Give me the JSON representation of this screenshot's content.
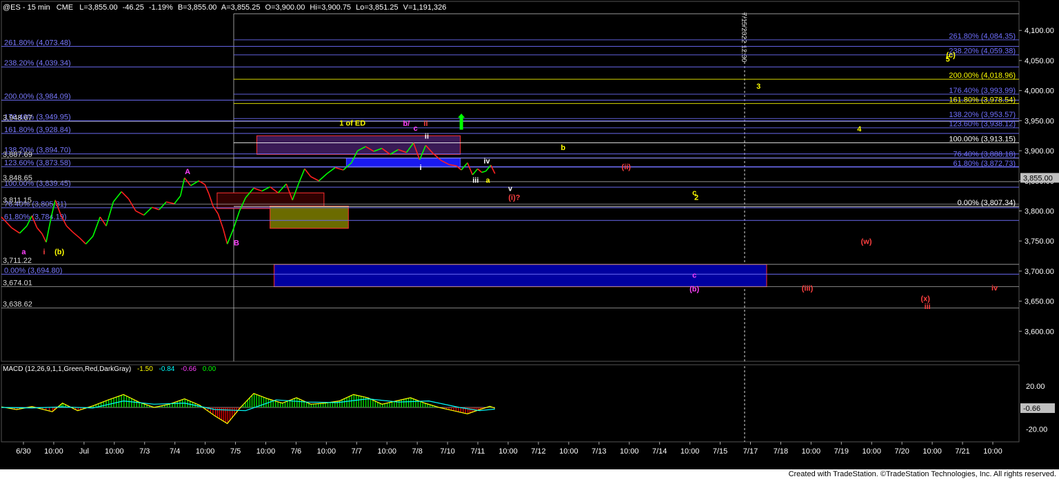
{
  "header": {
    "symbol": "@ES - 15 min",
    "exchange": "CME",
    "last": "L=3,855.00",
    "change": "-46.25",
    "change_pct": "-1.19%",
    "bid": "B=3,855.00",
    "ask": "A=3,855.25",
    "open": "O=3,900.00",
    "high": "Hi=3,900.75",
    "low": "Lo=3,851.25",
    "volume": "V=1,191,326"
  },
  "footer": {
    "credit": "Created with TradeStation. ©TradeStation Technologies, Inc. All rights reserved."
  },
  "colors": {
    "bull": "#00ff00",
    "bear": "#ff2020",
    "fib_left": "#7070ff",
    "fib_yellow": "#ffffff",
    "fib_right": "#4040ff",
    "price_box": "#ff4040"
  },
  "chart_data": {
    "type": "line",
    "price_axis": {
      "ylim": [
        3550,
        4130
      ],
      "ticks": [
        "4,100.00",
        "4,050.00",
        "4,000.00",
        "3,950.00",
        "3,900.00",
        "3,850.00",
        "3,800.00",
        "3,750.00",
        "3,700.00",
        "3,650.00",
        "3,600.00"
      ],
      "tick_values": [
        4100,
        4050,
        4000,
        3950,
        3900,
        3850,
        3800,
        3750,
        3700,
        3650,
        3600
      ],
      "last_label": "3,855.00",
      "last_value": 3855
    },
    "macd_axis": {
      "ylim": [
        -32,
        32
      ],
      "ticks": [
        "20.00",
        "-20.00"
      ],
      "tick_values": [
        20,
        -20
      ],
      "last_label": "-0.66",
      "last_value": -0.66
    },
    "x_ticks": [
      "6/30",
      "10:00",
      "Jul",
      "10:00",
      "7/3",
      "7/4",
      "10:00",
      "7/5",
      "10:00",
      "7/6",
      "10:00",
      "7/7",
      "10:00",
      "7/8",
      "7/10",
      "7/11",
      "10:00",
      "7/12",
      "10:00",
      "7/13",
      "10:00",
      "7/14",
      "10:00",
      "7/15",
      "7/17",
      "7/18",
      "10:00",
      "7/19",
      "10:00",
      "7/20",
      "10:00",
      "7/21",
      "10:00"
    ],
    "macd_legend": {
      "label": "MACD (12,26,9,1,1,Green,Red,DarkGray)",
      "v1": "-1.50",
      "v2": "-0.84",
      "v3": "-0.66",
      "v4": "0.00"
    },
    "vertical_marker_label": "7/15/2022 12:30",
    "left_fib": [
      {
        "label": "261.80% (4,073.48)",
        "value": 4073.48
      },
      {
        "label": "238.20% (4,039.34)",
        "value": 4039.34
      },
      {
        "label": "200.00% (3,984.09)",
        "value": 3984.09
      },
      {
        "label": "176.40% (3,949.95)",
        "value": 3949.95
      },
      {
        "label": "161.80% (3,928.84)",
        "value": 3928.84
      },
      {
        "label": "138.20% (3,894.70)",
        "value": 3894.7
      },
      {
        "label": "123.60% (3,873.58)",
        "value": 3873.58
      },
      {
        "label": "100.00% (3,839.45)",
        "value": 3839.45
      },
      {
        "label": "76.40% (3,805.31)",
        "value": 3805.31
      },
      {
        "label": "61.80% (3,784.19)",
        "value": 3784.19
      },
      {
        "label": "0.00% (3,694.80)",
        "value": 3694.8
      }
    ],
    "left_levels": [
      {
        "label": "3,948.67",
        "value": 3948.67
      },
      {
        "label": "3,887.69",
        "value": 3887.69
      },
      {
        "label": "3,848.65",
        "value": 3848.65
      },
      {
        "label": "3,811.15",
        "value": 3811.15
      },
      {
        "label": "3,711.22",
        "value": 3711.22
      },
      {
        "label": "3,674.01",
        "value": 3674.01
      },
      {
        "label": "3,638.62",
        "value": 3638.62
      }
    ],
    "right_fib": [
      {
        "label": "261.80% (4,084.35)",
        "value": 4084.35,
        "color": "#7070ff"
      },
      {
        "label": "238.20% (4,059.38)",
        "value": 4059.38,
        "color": "#7070ff"
      },
      {
        "label": "200.00% (4,018.96)",
        "value": 4018.96,
        "color": "#ffff00"
      },
      {
        "label": "176.40% (3,993.99)",
        "value": 3993.99,
        "color": "#7070ff"
      },
      {
        "label": "161.80% (3,978.54)",
        "value": 3978.54,
        "color": "#ffff00"
      },
      {
        "label": "138.20% (3,953.57)",
        "value": 3953.57,
        "color": "#7070ff"
      },
      {
        "label": "123.60% (3,938.12)",
        "value": 3938.12,
        "color": "#7070ff"
      },
      {
        "label": "100.00% (3,913.15)",
        "value": 3913.15,
        "color": "#ffffff"
      },
      {
        "label": "76.40% (3,888.18)",
        "value": 3888.18,
        "color": "#7070ff"
      },
      {
        "label": "61.80% (3,872.73)",
        "value": 3872.73,
        "color": "#7070ff"
      },
      {
        "label": "0.00% (3,807.34)",
        "value": 3807.34,
        "color": "#ffffff"
      }
    ],
    "annotations": [
      {
        "text": "1 of ED",
        "color": "#ffff00",
        "t": 0.345,
        "v": 3942
      },
      {
        "text": "b/",
        "color": "#ff40ff",
        "t": 0.398,
        "v": 3941
      },
      {
        "text": "ii",
        "color": "#ff4040",
        "t": 0.417,
        "v": 3941
      },
      {
        "text": "c",
        "color": "#ff40ff",
        "t": 0.407,
        "v": 3933
      },
      {
        "text": "ii",
        "color": "#ffffff",
        "t": 0.418,
        "v": 3920
      },
      {
        "text": "i",
        "color": "#ffffff",
        "t": 0.412,
        "v": 3868
      },
      {
        "text": "iv",
        "color": "#ffffff",
        "t": 0.477,
        "v": 3879
      },
      {
        "text": "iii",
        "color": "#ffffff",
        "t": 0.466,
        "v": 3847
      },
      {
        "text": "a",
        "color": "#ffff00",
        "t": 0.478,
        "v": 3847
      },
      {
        "text": "v",
        "color": "#ffffff",
        "t": 0.5,
        "v": 3833
      },
      {
        "text": "(i)?",
        "color": "#ff4040",
        "t": 0.504,
        "v": 3818
      },
      {
        "text": "(ii)",
        "color": "#ff4040",
        "t": 0.614,
        "v": 3869
      },
      {
        "text": "b",
        "color": "#ffff00",
        "t": 0.552,
        "v": 3901
      },
      {
        "text": "c",
        "color": "#ffff00",
        "t": 0.681,
        "v": 3826
      },
      {
        "text": "2",
        "color": "#ffff00",
        "t": 0.683,
        "v": 3818
      },
      {
        "text": "3",
        "color": "#ffff00",
        "t": 0.744,
        "v": 4003
      },
      {
        "text": "4",
        "color": "#ffff00",
        "t": 0.843,
        "v": 3932
      },
      {
        "text": "(c)",
        "color": "#ffff00",
        "t": 0.933,
        "v": 4055
      },
      {
        "text": "5",
        "color": "#ffff00",
        "t": 0.93,
        "v": 4048
      },
      {
        "text": "A",
        "color": "#ff40ff",
        "t": 0.183,
        "v": 3861
      },
      {
        "text": "B",
        "color": "#ff40ff",
        "t": 0.231,
        "v": 3743
      },
      {
        "text": "a",
        "color": "#ff40ff",
        "t": 0.022,
        "v": 3728
      },
      {
        "text": "i",
        "color": "#ff4040",
        "t": 0.042,
        "v": 3728
      },
      {
        "text": "(b)",
        "color": "#ffff00",
        "t": 0.057,
        "v": 3728
      },
      {
        "text": "c",
        "color": "#ff40ff",
        "t": 0.681,
        "v": 3689
      },
      {
        "text": "(b)",
        "color": "#ff40ff",
        "t": 0.681,
        "v": 3666
      },
      {
        "text": "(iii)",
        "color": "#ff4040",
        "t": 0.792,
        "v": 3667
      },
      {
        "text": "(w)",
        "color": "#ff4040",
        "t": 0.85,
        "v": 3745
      },
      {
        "text": "(x)",
        "color": "#ff4040",
        "t": 0.908,
        "v": 3650
      },
      {
        "text": "iii",
        "color": "#ff4040",
        "t": 0.91,
        "v": 3637
      },
      {
        "text": "iv",
        "color": "#ff4040",
        "t": 0.976,
        "v": 3668
      }
    ],
    "price_path": [
      [
        0.0,
        3790
      ],
      [
        0.01,
        3772
      ],
      [
        0.018,
        3763
      ],
      [
        0.025,
        3775
      ],
      [
        0.03,
        3792
      ],
      [
        0.035,
        3772
      ],
      [
        0.04,
        3762
      ],
      [
        0.044,
        3748
      ],
      [
        0.049,
        3790
      ],
      [
        0.053,
        3818
      ],
      [
        0.058,
        3795
      ],
      [
        0.064,
        3775
      ],
      [
        0.07,
        3765
      ],
      [
        0.077,
        3755
      ],
      [
        0.083,
        3745
      ],
      [
        0.09,
        3758
      ],
      [
        0.097,
        3790
      ],
      [
        0.103,
        3775
      ],
      [
        0.11,
        3815
      ],
      [
        0.118,
        3832
      ],
      [
        0.125,
        3820
      ],
      [
        0.132,
        3800
      ],
      [
        0.14,
        3793
      ],
      [
        0.148,
        3806
      ],
      [
        0.155,
        3802
      ],
      [
        0.162,
        3815
      ],
      [
        0.17,
        3812
      ],
      [
        0.176,
        3825
      ],
      [
        0.18,
        3855
      ],
      [
        0.186,
        3842
      ],
      [
        0.194,
        3850
      ],
      [
        0.2,
        3844
      ],
      [
        0.204,
        3828
      ],
      [
        0.208,
        3808
      ],
      [
        0.213,
        3795
      ],
      [
        0.218,
        3770
      ],
      [
        0.222,
        3745
      ],
      [
        0.228,
        3770
      ],
      [
        0.234,
        3800
      ],
      [
        0.24,
        3822
      ],
      [
        0.248,
        3838
      ],
      [
        0.256,
        3833
      ],
      [
        0.264,
        3840
      ],
      [
        0.272,
        3830
      ],
      [
        0.28,
        3845
      ],
      [
        0.286,
        3818
      ],
      [
        0.292,
        3845
      ],
      [
        0.298,
        3870
      ],
      [
        0.304,
        3857
      ],
      [
        0.312,
        3850
      ],
      [
        0.32,
        3862
      ],
      [
        0.328,
        3872
      ],
      [
        0.336,
        3868
      ],
      [
        0.344,
        3880
      ],
      [
        0.35,
        3900
      ],
      [
        0.358,
        3907
      ],
      [
        0.366,
        3899
      ],
      [
        0.374,
        3904
      ],
      [
        0.382,
        3894
      ],
      [
        0.39,
        3902
      ],
      [
        0.398,
        3897
      ],
      [
        0.405,
        3913
      ],
      [
        0.411,
        3885
      ],
      [
        0.417,
        3909
      ],
      [
        0.424,
        3896
      ],
      [
        0.432,
        3884
      ],
      [
        0.44,
        3877
      ],
      [
        0.447,
        3875
      ],
      [
        0.452,
        3868
      ],
      [
        0.458,
        3880
      ],
      [
        0.463,
        3860
      ],
      [
        0.468,
        3870
      ],
      [
        0.472,
        3864
      ],
      [
        0.476,
        3866
      ],
      [
        0.481,
        3876
      ],
      [
        0.485,
        3862
      ]
    ],
    "macd_path": [
      [
        0.0,
        0.5
      ],
      [
        0.015,
        -2.0
      ],
      [
        0.03,
        0.8
      ],
      [
        0.05,
        -4.0
      ],
      [
        0.06,
        4.0
      ],
      [
        0.075,
        -3.0
      ],
      [
        0.09,
        1.5
      ],
      [
        0.105,
        7.0
      ],
      [
        0.12,
        12.0
      ],
      [
        0.135,
        5.0
      ],
      [
        0.15,
        0.0
      ],
      [
        0.165,
        3.0
      ],
      [
        0.18,
        8.0
      ],
      [
        0.195,
        2.0
      ],
      [
        0.21,
        -8.0
      ],
      [
        0.222,
        -15.0
      ],
      [
        0.235,
        0.0
      ],
      [
        0.248,
        13.0
      ],
      [
        0.262,
        8.0
      ],
      [
        0.276,
        4.0
      ],
      [
        0.29,
        9.0
      ],
      [
        0.304,
        3.0
      ],
      [
        0.318,
        4.0
      ],
      [
        0.332,
        6.0
      ],
      [
        0.346,
        12.0
      ],
      [
        0.36,
        9.0
      ],
      [
        0.374,
        3.0
      ],
      [
        0.388,
        6.0
      ],
      [
        0.402,
        9.0
      ],
      [
        0.416,
        4.0
      ],
      [
        0.43,
        0.0
      ],
      [
        0.444,
        -3.0
      ],
      [
        0.458,
        -6.0
      ],
      [
        0.47,
        -2.0
      ],
      [
        0.48,
        1.0
      ],
      [
        0.485,
        -0.66
      ]
    ],
    "signal_path": [
      [
        0.0,
        0.0
      ],
      [
        0.03,
        -0.5
      ],
      [
        0.06,
        0.5
      ],
      [
        0.09,
        -0.5
      ],
      [
        0.12,
        6.0
      ],
      [
        0.15,
        3.0
      ],
      [
        0.18,
        4.0
      ],
      [
        0.21,
        -2.0
      ],
      [
        0.24,
        -3.0
      ],
      [
        0.27,
        7.0
      ],
      [
        0.3,
        5.0
      ],
      [
        0.33,
        4.5
      ],
      [
        0.36,
        8.0
      ],
      [
        0.39,
        5.0
      ],
      [
        0.42,
        6.0
      ],
      [
        0.45,
        0.0
      ],
      [
        0.47,
        -3.0
      ],
      [
        0.485,
        -1.5
      ]
    ],
    "zones": [
      {
        "t0": 0.251,
        "t1": 0.451,
        "v0": 3925,
        "v1": 3894,
        "fill": "#3a1a56",
        "stroke": "#ff3030"
      },
      {
        "t0": 0.339,
        "t1": 0.451,
        "v0": 3888,
        "v1": 3873,
        "fill": "#1a1af0",
        "stroke": "#5050ff"
      },
      {
        "t0": 0.212,
        "t1": 0.317,
        "v0": 3830,
        "v1": 3804,
        "fill": "#300000",
        "stroke": "#ff3030"
      },
      {
        "t0": 0.264,
        "t1": 0.341,
        "v0": 3808,
        "v1": 3771,
        "fill": "#6b6b00",
        "stroke": "#ff3030"
      },
      {
        "t0": 0.268,
        "t1": 0.752,
        "v0": 3711,
        "v1": 3674,
        "fill": "#0000a0",
        "stroke": "#ff3030"
      }
    ],
    "green_arrow": {
      "t": 0.452,
      "v0": 3935,
      "v1": 3955
    }
  }
}
